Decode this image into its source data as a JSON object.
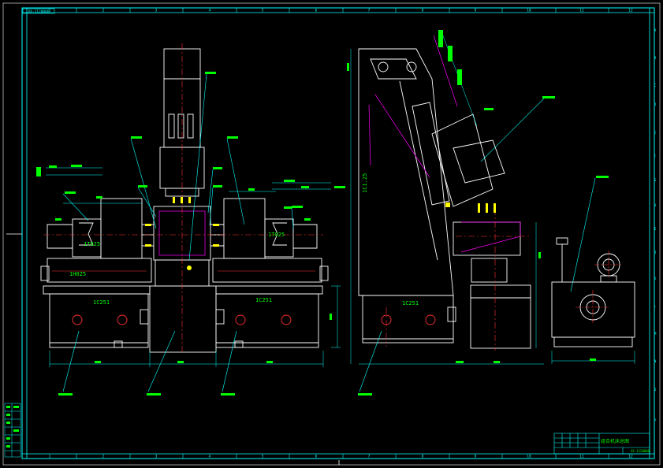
{
  "drawing": {
    "drawing_number": "XX-1120000",
    "colors": {
      "frame": "#00ffff",
      "outline": "#ffffff",
      "centerline": "#ff3030",
      "label": "#00ff00",
      "dim": "#00ffff",
      "accent": "#ff00ff",
      "note": "#ffff00"
    },
    "border_columns": [
      "1",
      "2",
      "3",
      "4",
      "5",
      "6",
      "7",
      "8",
      "9",
      "10",
      "11",
      "12"
    ],
    "border_rows": [
      "A",
      "B",
      "C",
      "D",
      "E",
      "F",
      "G",
      "H",
      "I",
      "J",
      "K",
      "L",
      "M",
      "N",
      "O",
      "P"
    ],
    "part_labels": {
      "left_base": "1C251",
      "right_base": "1C251",
      "side_base": "1C251",
      "column": "1C1.25",
      "left_head": "1T025",
      "right_head": "1T025",
      "left_slide": "1H025"
    },
    "title_block": {
      "title": "组合机床总图",
      "code": "XX-1120000"
    }
  }
}
